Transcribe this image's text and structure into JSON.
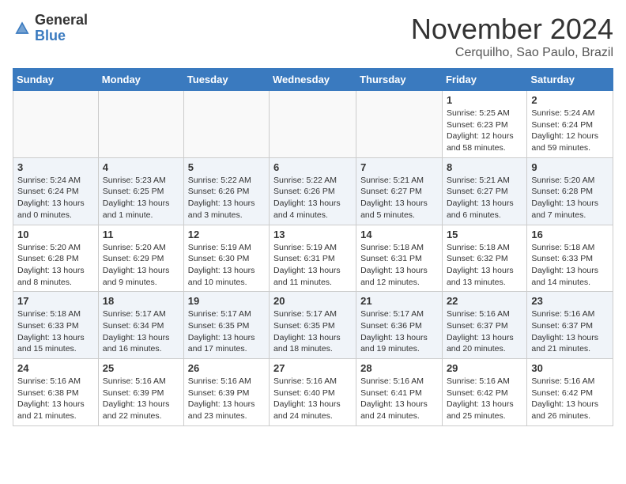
{
  "header": {
    "logo_general": "General",
    "logo_blue": "Blue",
    "month_title": "November 2024",
    "location": "Cerquilho, Sao Paulo, Brazil"
  },
  "weekdays": [
    "Sunday",
    "Monday",
    "Tuesday",
    "Wednesday",
    "Thursday",
    "Friday",
    "Saturday"
  ],
  "weeks": [
    [
      {
        "day": "",
        "info": ""
      },
      {
        "day": "",
        "info": ""
      },
      {
        "day": "",
        "info": ""
      },
      {
        "day": "",
        "info": ""
      },
      {
        "day": "",
        "info": ""
      },
      {
        "day": "1",
        "info": "Sunrise: 5:25 AM\nSunset: 6:23 PM\nDaylight: 12 hours and 58 minutes."
      },
      {
        "day": "2",
        "info": "Sunrise: 5:24 AM\nSunset: 6:24 PM\nDaylight: 12 hours and 59 minutes."
      }
    ],
    [
      {
        "day": "3",
        "info": "Sunrise: 5:24 AM\nSunset: 6:24 PM\nDaylight: 13 hours and 0 minutes."
      },
      {
        "day": "4",
        "info": "Sunrise: 5:23 AM\nSunset: 6:25 PM\nDaylight: 13 hours and 1 minute."
      },
      {
        "day": "5",
        "info": "Sunrise: 5:22 AM\nSunset: 6:26 PM\nDaylight: 13 hours and 3 minutes."
      },
      {
        "day": "6",
        "info": "Sunrise: 5:22 AM\nSunset: 6:26 PM\nDaylight: 13 hours and 4 minutes."
      },
      {
        "day": "7",
        "info": "Sunrise: 5:21 AM\nSunset: 6:27 PM\nDaylight: 13 hours and 5 minutes."
      },
      {
        "day": "8",
        "info": "Sunrise: 5:21 AM\nSunset: 6:27 PM\nDaylight: 13 hours and 6 minutes."
      },
      {
        "day": "9",
        "info": "Sunrise: 5:20 AM\nSunset: 6:28 PM\nDaylight: 13 hours and 7 minutes."
      }
    ],
    [
      {
        "day": "10",
        "info": "Sunrise: 5:20 AM\nSunset: 6:28 PM\nDaylight: 13 hours and 8 minutes."
      },
      {
        "day": "11",
        "info": "Sunrise: 5:20 AM\nSunset: 6:29 PM\nDaylight: 13 hours and 9 minutes."
      },
      {
        "day": "12",
        "info": "Sunrise: 5:19 AM\nSunset: 6:30 PM\nDaylight: 13 hours and 10 minutes."
      },
      {
        "day": "13",
        "info": "Sunrise: 5:19 AM\nSunset: 6:31 PM\nDaylight: 13 hours and 11 minutes."
      },
      {
        "day": "14",
        "info": "Sunrise: 5:18 AM\nSunset: 6:31 PM\nDaylight: 13 hours and 12 minutes."
      },
      {
        "day": "15",
        "info": "Sunrise: 5:18 AM\nSunset: 6:32 PM\nDaylight: 13 hours and 13 minutes."
      },
      {
        "day": "16",
        "info": "Sunrise: 5:18 AM\nSunset: 6:33 PM\nDaylight: 13 hours and 14 minutes."
      }
    ],
    [
      {
        "day": "17",
        "info": "Sunrise: 5:18 AM\nSunset: 6:33 PM\nDaylight: 13 hours and 15 minutes."
      },
      {
        "day": "18",
        "info": "Sunrise: 5:17 AM\nSunset: 6:34 PM\nDaylight: 13 hours and 16 minutes."
      },
      {
        "day": "19",
        "info": "Sunrise: 5:17 AM\nSunset: 6:35 PM\nDaylight: 13 hours and 17 minutes."
      },
      {
        "day": "20",
        "info": "Sunrise: 5:17 AM\nSunset: 6:35 PM\nDaylight: 13 hours and 18 minutes."
      },
      {
        "day": "21",
        "info": "Sunrise: 5:17 AM\nSunset: 6:36 PM\nDaylight: 13 hours and 19 minutes."
      },
      {
        "day": "22",
        "info": "Sunrise: 5:16 AM\nSunset: 6:37 PM\nDaylight: 13 hours and 20 minutes."
      },
      {
        "day": "23",
        "info": "Sunrise: 5:16 AM\nSunset: 6:37 PM\nDaylight: 13 hours and 21 minutes."
      }
    ],
    [
      {
        "day": "24",
        "info": "Sunrise: 5:16 AM\nSunset: 6:38 PM\nDaylight: 13 hours and 21 minutes."
      },
      {
        "day": "25",
        "info": "Sunrise: 5:16 AM\nSunset: 6:39 PM\nDaylight: 13 hours and 22 minutes."
      },
      {
        "day": "26",
        "info": "Sunrise: 5:16 AM\nSunset: 6:39 PM\nDaylight: 13 hours and 23 minutes."
      },
      {
        "day": "27",
        "info": "Sunrise: 5:16 AM\nSunset: 6:40 PM\nDaylight: 13 hours and 24 minutes."
      },
      {
        "day": "28",
        "info": "Sunrise: 5:16 AM\nSunset: 6:41 PM\nDaylight: 13 hours and 24 minutes."
      },
      {
        "day": "29",
        "info": "Sunrise: 5:16 AM\nSunset: 6:42 PM\nDaylight: 13 hours and 25 minutes."
      },
      {
        "day": "30",
        "info": "Sunrise: 5:16 AM\nSunset: 6:42 PM\nDaylight: 13 hours and 26 minutes."
      }
    ]
  ]
}
